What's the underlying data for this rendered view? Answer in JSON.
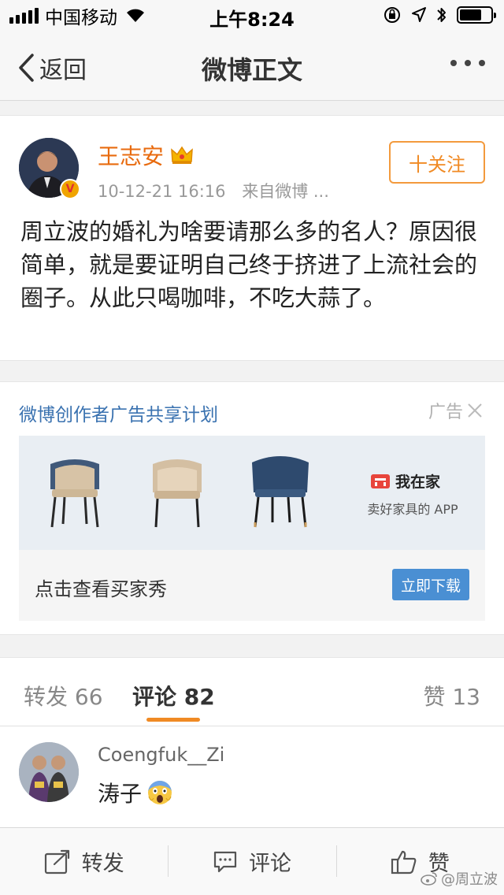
{
  "status_bar": {
    "carrier": "中国移动",
    "time": "上午8:24",
    "battery_level": 0.7
  },
  "nav": {
    "back_label": "返回",
    "title": "微博正文"
  },
  "post": {
    "author": "王志安",
    "verified_badge": "V",
    "date": "10-12-21 16:16",
    "source": "来自微博 ...",
    "follow_label": "十关注",
    "text": "周立波的婚礼为啥要请那么多的名人？原因很简单，就是要证明自己终于挤进了上流社会的圈子。从此只喝咖啡，不吃大蒜了。"
  },
  "ad": {
    "title": "微博创作者广告共享计划",
    "label": "广告",
    "brand_name": "我在家",
    "slogan": "卖好家具的 APP",
    "cta_text": "点击查看买家秀",
    "download_label": "立即下载"
  },
  "tabs": {
    "repost": "转发 66",
    "comment": "评论 82",
    "like": "赞 13"
  },
  "comment": {
    "user": "Coengfuk__Zi",
    "text": "涛子"
  },
  "toolbar": {
    "repost": "转发",
    "comment": "评论",
    "like": "赞"
  },
  "watermark": "@周立波",
  "colors": {
    "accent_orange": "#f08a24",
    "link_blue": "#3a72b0",
    "button_blue": "#4a8fd3"
  }
}
